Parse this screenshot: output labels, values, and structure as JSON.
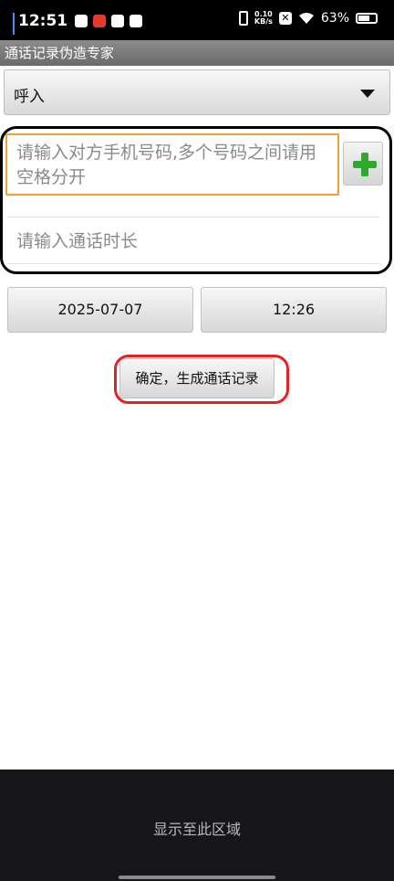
{
  "status_bar": {
    "time": "12:51",
    "net_speed_value": "0.10",
    "net_speed_unit": "KB/s",
    "battery": "63%"
  },
  "app": {
    "title": "通话记录伪造专家"
  },
  "call_type": {
    "selected": "呼入"
  },
  "phone_number": {
    "placeholder": "请输入对方手机号码,多个号码之间请用空格分开"
  },
  "duration": {
    "placeholder": "请输入通话时长"
  },
  "date_button": {
    "label": "2025-07-07"
  },
  "time_button": {
    "label": "12:26"
  },
  "confirm_button": {
    "label": "确定，生成通话记录"
  },
  "bottom_area": {
    "text": "显示至此区域"
  },
  "colors": {
    "focus_border": "#f0a030",
    "add_icon": "#2fa830",
    "annotation_black": "#000000",
    "annotation_red": "#e32222",
    "bottom_background": "#17161b"
  }
}
